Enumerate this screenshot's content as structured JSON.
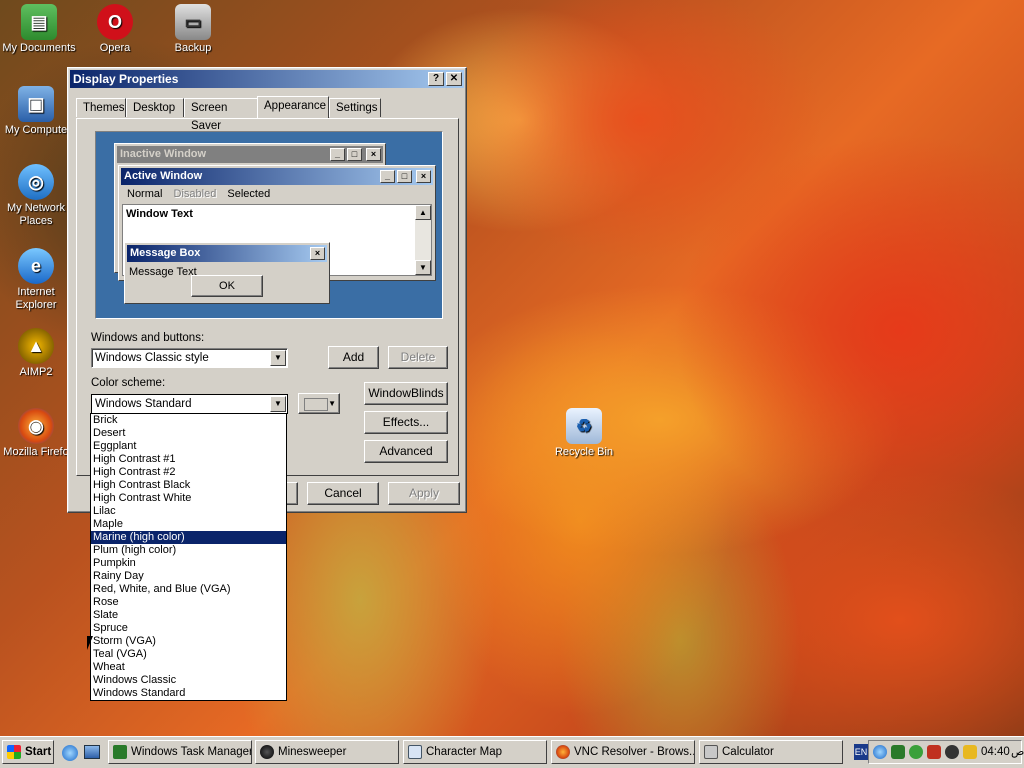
{
  "desktop": {
    "icons": [
      {
        "label": "My Documents",
        "icon": "folder-icon"
      },
      {
        "label": "Opera",
        "icon": "opera-icon"
      },
      {
        "label": "Backup",
        "icon": "backup-drive-icon"
      },
      {
        "label": "My Compute",
        "icon": "computer-icon"
      },
      {
        "label": "My Network Places",
        "icon": "network-icon"
      },
      {
        "label": "Internet Explorer",
        "icon": "ie-icon"
      },
      {
        "label": "AIMP2",
        "icon": "aimp-icon"
      },
      {
        "label": "Mozilla Firefo",
        "icon": "firefox-icon"
      },
      {
        "label": "Recycle Bin",
        "icon": "recycle-bin-icon"
      }
    ]
  },
  "dialog": {
    "title": "Display Properties",
    "help_btn": "?",
    "close_btn": "✕",
    "tabs": [
      "Themes",
      "Desktop",
      "Screen Saver",
      "Appearance",
      "Settings"
    ],
    "active_tab": "Appearance",
    "preview": {
      "inactive_title": "Inactive Window",
      "active_title": "Active Window",
      "menu": [
        "Normal",
        "Disabled",
        "Selected"
      ],
      "window_text": "Window Text",
      "msgbox_title": "Message Box",
      "msgbox_text": "Message Text",
      "ok": "OK"
    },
    "windows_buttons_label": "Windows and buttons:",
    "windows_buttons_value": "Windows Classic style",
    "add": "Add",
    "delete": "Delete",
    "color_scheme_label": "Color scheme:",
    "color_scheme_value": "Windows Standard",
    "windowblinds": "WindowBlinds",
    "effects": "Effects...",
    "advanced": "Advanced",
    "cancel": "Cancel",
    "apply": "Apply",
    "scheme_options": [
      "Brick",
      "Desert",
      "Eggplant",
      "High Contrast #1",
      "High Contrast #2",
      "High Contrast Black",
      "High Contrast White",
      "Lilac",
      "Maple",
      "Marine (high color)",
      "Plum (high color)",
      "Pumpkin",
      "Rainy Day",
      "Red, White, and Blue (VGA)",
      "Rose",
      "Slate",
      "Spruce",
      "Storm (VGA)",
      "Teal (VGA)",
      "Wheat",
      "Windows Classic",
      "Windows Standard"
    ],
    "highlighted_option": "Marine (high color)"
  },
  "taskbar": {
    "start": "Start",
    "tasks": [
      {
        "label": "Windows Task Manager",
        "icon": "task-manager-icon"
      },
      {
        "label": "Minesweeper",
        "icon": "minesweeper-icon"
      },
      {
        "label": "Character Map",
        "icon": "charmap-icon"
      },
      {
        "label": "VNC Resolver - Brows...",
        "icon": "firefox-icon"
      },
      {
        "label": "Calculator",
        "icon": "calculator-icon"
      }
    ],
    "lang": "EN",
    "clock": "04:40",
    "ampm": "ص"
  },
  "colors": {
    "title_active_start": "#0a246a",
    "title_active_end": "#a6caf0",
    "title_inactive": "#808080",
    "face": "#d4d0c8",
    "preview_bg": "#3a6ea5"
  }
}
